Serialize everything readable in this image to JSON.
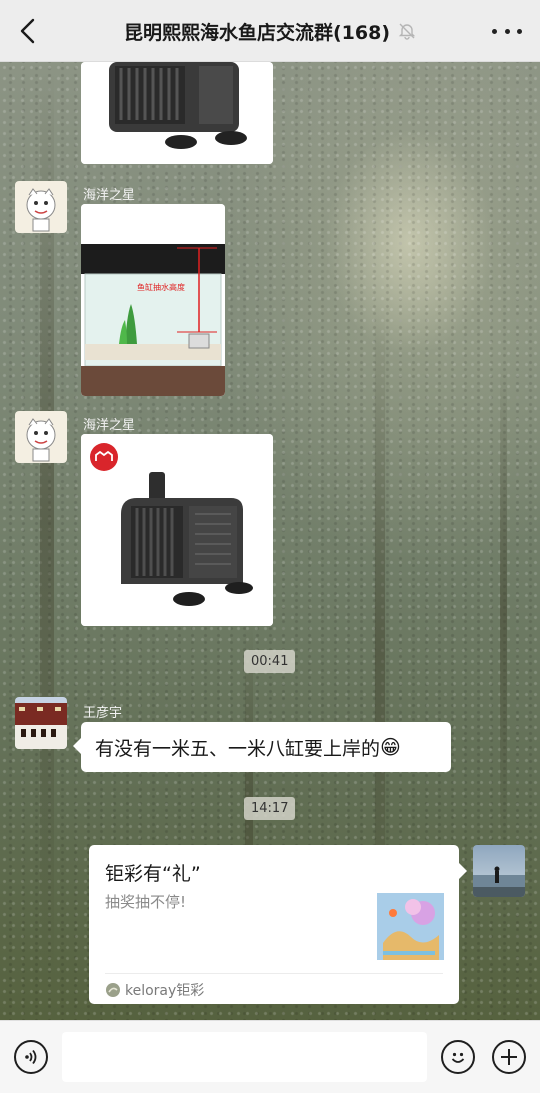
{
  "header": {
    "title": "昆明熙熙海水鱼店交流群(168)",
    "back_icon": "chevron-left-icon",
    "mute_icon": "bell-off-icon",
    "more_icon": "more-dots-icon"
  },
  "messages": {
    "msg1": {
      "type": "image",
      "content": "water-pump-image"
    },
    "msg2": {
      "sender": "海洋之星",
      "type": "image",
      "image_label": "鱼缸抽水高度"
    },
    "msg3": {
      "sender": "海洋之星",
      "type": "image",
      "content": "water-pump-image",
      "badge_icon": "tmall-badge-icon"
    },
    "time1": "00:41",
    "msg4": {
      "sender": "王彦宇",
      "text": "有没有一米五、一米八缸要上岸的",
      "emoji": "😁"
    },
    "time2": "14:17",
    "msg5": {
      "type": "card",
      "title": "钜彩有“礼”",
      "desc": "抽奖抽不停!",
      "source": "keloray钜彩"
    }
  },
  "bottom_bar": {
    "voice_icon": "voice-icon",
    "input_value": "",
    "emoji_icon": "emoji-icon",
    "plus_icon": "plus-icon"
  },
  "colors": {
    "header_bg": "#ededed",
    "bubble_bg": "#ffffff",
    "bottom_bg": "#f6f6f6"
  }
}
